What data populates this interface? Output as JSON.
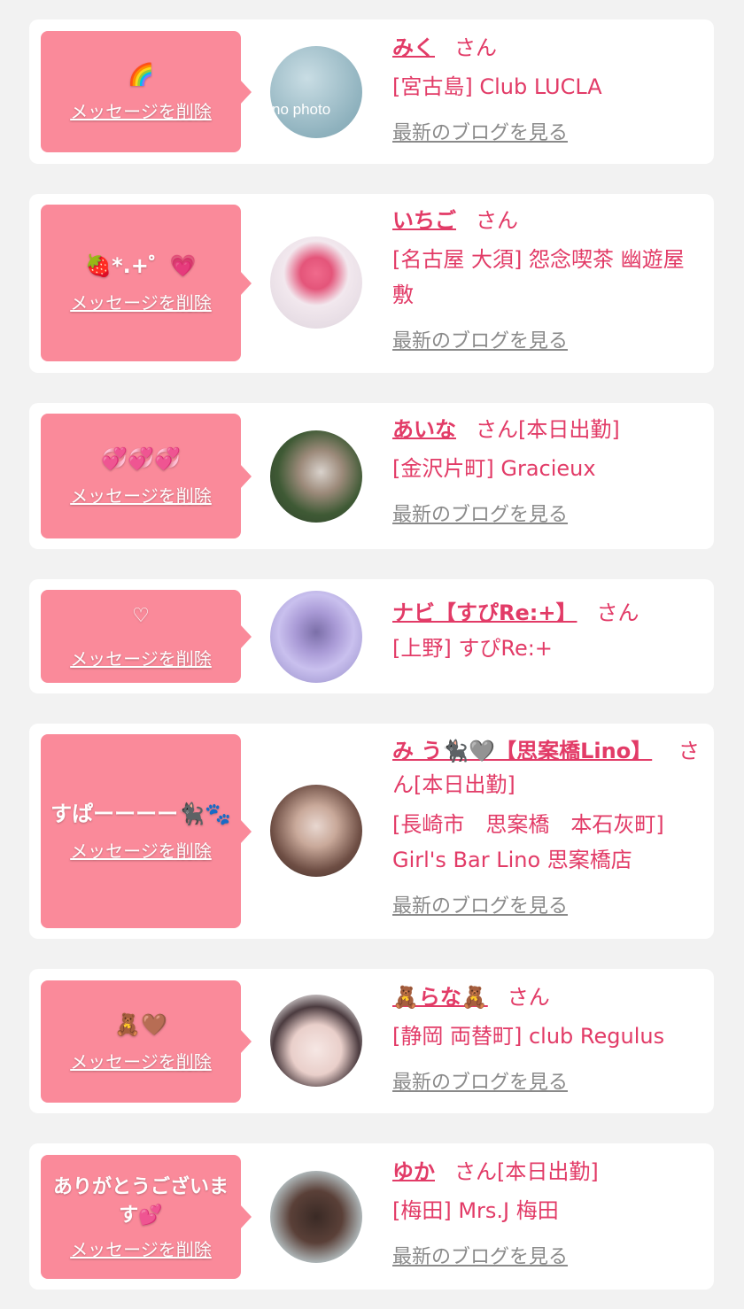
{
  "delete_label": "メッセージを削除",
  "san_label": "さん",
  "blog_label": "最新のブログを見る",
  "colors": {
    "background": "#f2f2f2",
    "card": "#ffffff",
    "bubble": "#fa8a9a",
    "accent_text": "#e23b67",
    "link_gray": "#8a8a8a"
  },
  "entries": [
    {
      "message": "🌈",
      "name": "みく",
      "status": "",
      "shop": "[宮古島] Club LUCLA",
      "avatar_icon": "no-photo-avatar"
    },
    {
      "message": "🍓*.+゜💗",
      "name": "いちご",
      "status": "",
      "shop": "[名古屋 大須] 怨念喫茶 幽遊屋敷",
      "avatar_icon": "avatar"
    },
    {
      "message": "💞💞💞",
      "name": "あいな",
      "status": "[本日出勤]",
      "shop": "[金沢片町] Gracieux",
      "avatar_icon": "avatar"
    },
    {
      "message": "♡",
      "name": "ナビ【すぴRe:+】",
      "status": "",
      "shop": "[上野] すぴRe:+",
      "avatar_icon": "avatar"
    },
    {
      "message": "すぱーーーー🐈‍⬛🐾",
      "name": "み う🐈‍⬛🩶【思案橋Lino】",
      "status": "[本日出勤]",
      "shop": "[長崎市　思案橋　本石灰町] Girl's Bar Lino 思案橋店",
      "avatar_icon": "avatar"
    },
    {
      "message": "🧸🤎",
      "name": "🧸らな🧸",
      "status": "",
      "shop": "[静岡 両替町] club Regulus",
      "avatar_icon": "avatar"
    },
    {
      "message": "ありがとうございます💕",
      "name": "ゆか",
      "status": "[本日出勤]",
      "shop": "[梅田] Mrs.J 梅田",
      "avatar_icon": "avatar"
    }
  ]
}
